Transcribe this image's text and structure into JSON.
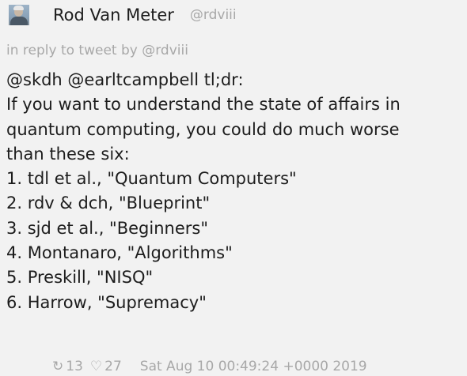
{
  "tweet": {
    "author_name": "Rod Van Meter",
    "author_handle": "@rdviii",
    "reply_line": "in reply to tweet by @rdviii",
    "lines": [
      "@skdh @earltcampbell tl;dr:",
      "If you want to understand the state of affairs in",
      "quantum computing, you could do much worse",
      "than these six:",
      "1. tdl et al., \"Quantum Computers\"",
      "2. rdv & dch, \"Blueprint\"",
      "3. sjd et al., \"Beginners\"",
      "4. Montanaro, \"Algorithms\"",
      "5. Preskill, \"NISQ\"",
      "6. Harrow, \"Supremacy\""
    ],
    "retweet_icon": "retweet-icon",
    "retweet_glyph": "↻",
    "retweet_count": "13",
    "like_icon": "heart-icon",
    "like_glyph": "♡",
    "like_count": "27",
    "timestamp": "Sat Aug 10 00:49:24 +0000 2019"
  }
}
